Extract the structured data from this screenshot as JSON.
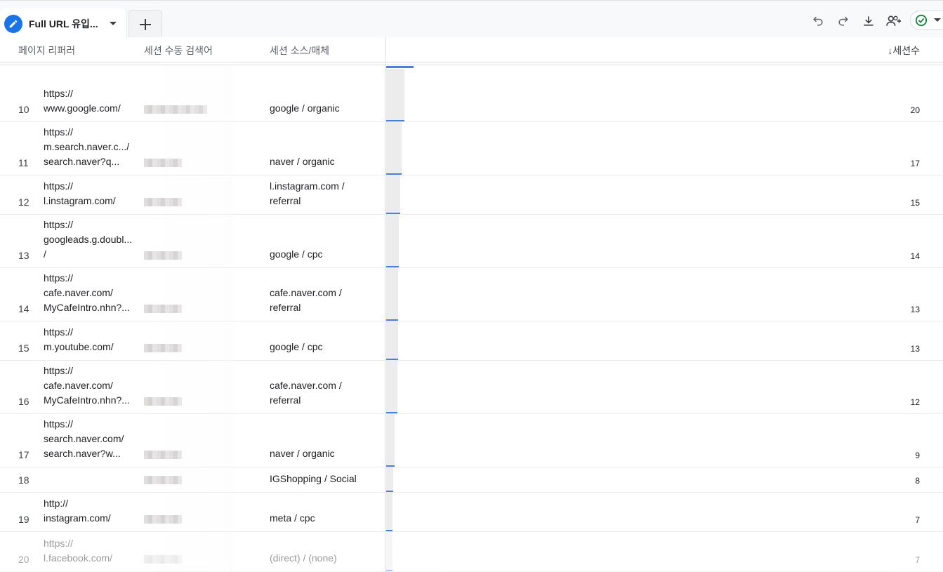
{
  "tab": {
    "title": "Full URL 유입...",
    "icon": "pencil-icon",
    "add_label": "+"
  },
  "toolbar": {
    "icons": [
      "undo-icon",
      "redo-icon",
      "download-icon",
      "share-user-icon",
      "check-circle-icon"
    ]
  },
  "columns": {
    "page_referrer": "페이지 리퍼러",
    "search_term": "세션 수동 검색어",
    "source_medium": "세션 소스/매체",
    "sessions": "↓세션수"
  },
  "rows": [
    {
      "num": "10",
      "url": [
        "https://",
        "www.google.com/"
      ],
      "source": [
        "google / organic"
      ],
      "sessions": "20"
    },
    {
      "num": "11",
      "url": [
        "https://",
        "m.search.naver.c.../",
        "search.naver?q..."
      ],
      "source": [
        "naver / organic"
      ],
      "sessions": "17"
    },
    {
      "num": "12",
      "url": [
        "https://",
        "l.instagram.com/"
      ],
      "source": [
        "l.instagram.com /",
        "referral"
      ],
      "sessions": "15"
    },
    {
      "num": "13",
      "url": [
        "https://",
        "googleads.g.doubl...",
        "/"
      ],
      "source": [
        "google / cpc"
      ],
      "sessions": "14"
    },
    {
      "num": "14",
      "url": [
        "https://",
        "cafe.naver.com/",
        "MyCafeIntro.nhn?..."
      ],
      "source": [
        "cafe.naver.com /",
        "referral"
      ],
      "sessions": "13"
    },
    {
      "num": "15",
      "url": [
        "https://",
        "m.youtube.com/"
      ],
      "source": [
        "google / cpc"
      ],
      "sessions": "13"
    },
    {
      "num": "16",
      "url": [
        "https://",
        "cafe.naver.com/",
        "MyCafeIntro.nhn?..."
      ],
      "source": [
        "cafe.naver.com /",
        "referral"
      ],
      "sessions": "12"
    },
    {
      "num": "17",
      "url": [
        "https://",
        "search.naver.com/",
        "search.naver?w..."
      ],
      "source": [
        "naver / organic"
      ],
      "sessions": "9"
    },
    {
      "num": "18",
      "url": [],
      "source": [
        "IGShopping / Social"
      ],
      "sessions": "8"
    },
    {
      "num": "19",
      "url": [
        "http://",
        "instagram.com/"
      ],
      "source": [
        "meta / cpc"
      ],
      "sessions": "7"
    },
    {
      "num": "20",
      "url": [
        "https://",
        "l.facebook.com/"
      ],
      "source": [
        "(direct) / (none)"
      ],
      "sessions": "7"
    }
  ],
  "colors": {
    "accent": "#1a73e8",
    "bar_line": "#4a7fd4",
    "bar_fill": "#ececec"
  }
}
